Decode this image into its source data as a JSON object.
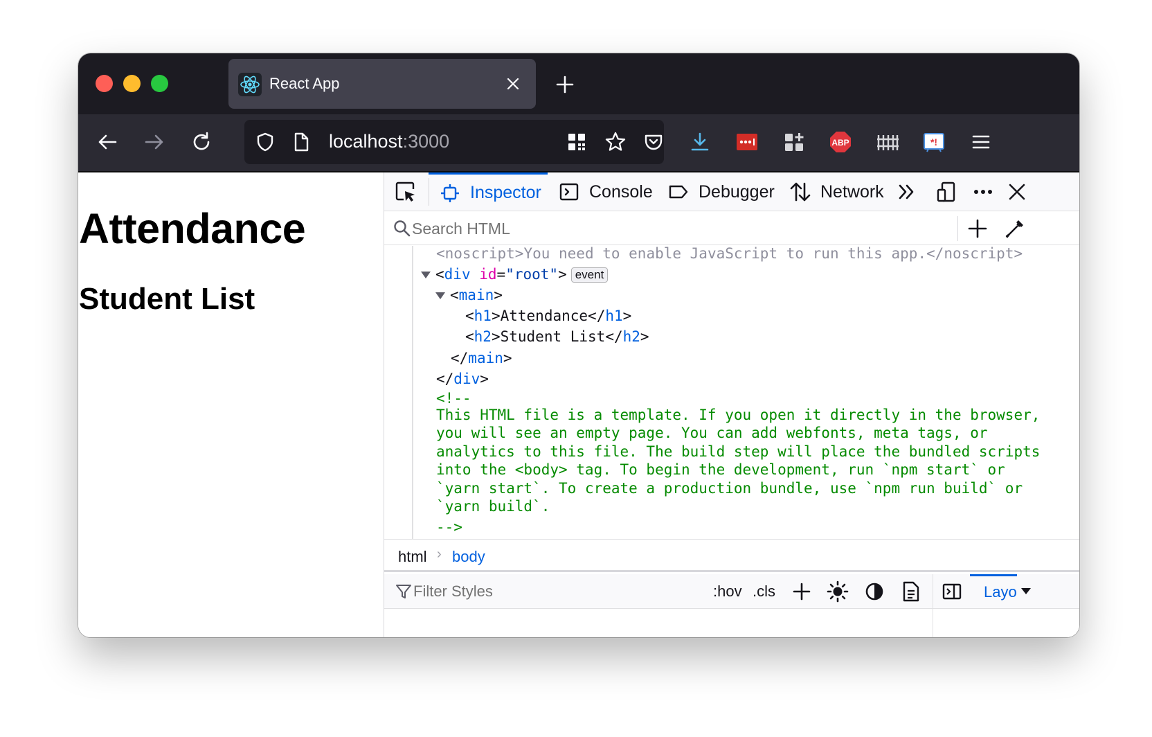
{
  "browser": {
    "tab_title": "React App",
    "url_host": "localhost",
    "url_port": ":3000"
  },
  "page": {
    "h1": "Attendance",
    "h2": "Student List"
  },
  "devtools": {
    "tabs": [
      {
        "label": "Inspector",
        "active": true
      },
      {
        "label": "Console"
      },
      {
        "label": "Debugger"
      },
      {
        "label": "Network"
      }
    ],
    "search_placeholder": "Search HTML",
    "markup": {
      "noscript_open": "<noscript>",
      "noscript_text": "You need to enable JavaScript to run this app.",
      "noscript_close": "</noscript>",
      "div_tag": "div",
      "div_attr": "id",
      "div_val": "\"root\"",
      "event_badge": "event",
      "main_tag": "main",
      "h1_tag": "h1",
      "h1_text": "Attendance",
      "h2_tag": "h2",
      "h2_text": "Student List",
      "comment_open": "<!--",
      "comment_text": "This HTML file is a template. If you open it directly in the browser, you will see an empty page. You can add webfonts, meta tags, or analytics to this file. The build step will place the bundled scripts into the <body> tag. To begin the development, run `npm start` or `yarn start`. To create a production bundle, use `npm run build` or `yarn build`.",
      "comment_close": "-->"
    },
    "breadcrumbs": [
      "html",
      "body"
    ],
    "rules": {
      "filter_placeholder": "Filter Styles",
      "hov": ":hov",
      "cls": ".cls",
      "layout_tab": "Layout"
    }
  },
  "colors": {
    "tabstrip": "#1c1b22",
    "toolbar": "#2b2a33",
    "accent": "#0060df",
    "comment": "#058b00"
  }
}
